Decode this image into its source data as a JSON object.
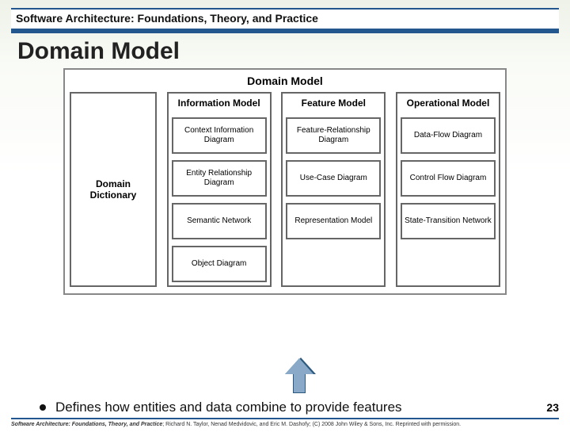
{
  "header": {
    "title": "Software Architecture: Foundations, Theory, and Practice"
  },
  "slide_title": "Domain Model",
  "diagram": {
    "title": "Domain Model",
    "dictionary": "Domain Dictionary",
    "columns": [
      {
        "title": "Information Model",
        "nodes": [
          "Context Information Diagram",
          "Entity Relationship Diagram",
          "Semantic Network",
          "Object Diagram"
        ]
      },
      {
        "title": "Feature Model",
        "nodes": [
          "Feature-Relationship Diagram",
          "Use-Case Diagram",
          "Representation Model"
        ]
      },
      {
        "title": "Operational Model",
        "nodes": [
          "Data-Flow Diagram",
          "Control Flow Diagram",
          "State-Transition Network"
        ]
      }
    ]
  },
  "bullet": "Defines how entities and data combine to provide features",
  "page_number": "23",
  "credits": {
    "book": "Software Architecture: Foundations, Theory, and Practice",
    "rest": "; Richard N. Taylor, Nenad Medvidovic, and Eric M. Dashofy; (C) 2008 John Wiley & Sons, Inc. Reprinted with permission."
  }
}
